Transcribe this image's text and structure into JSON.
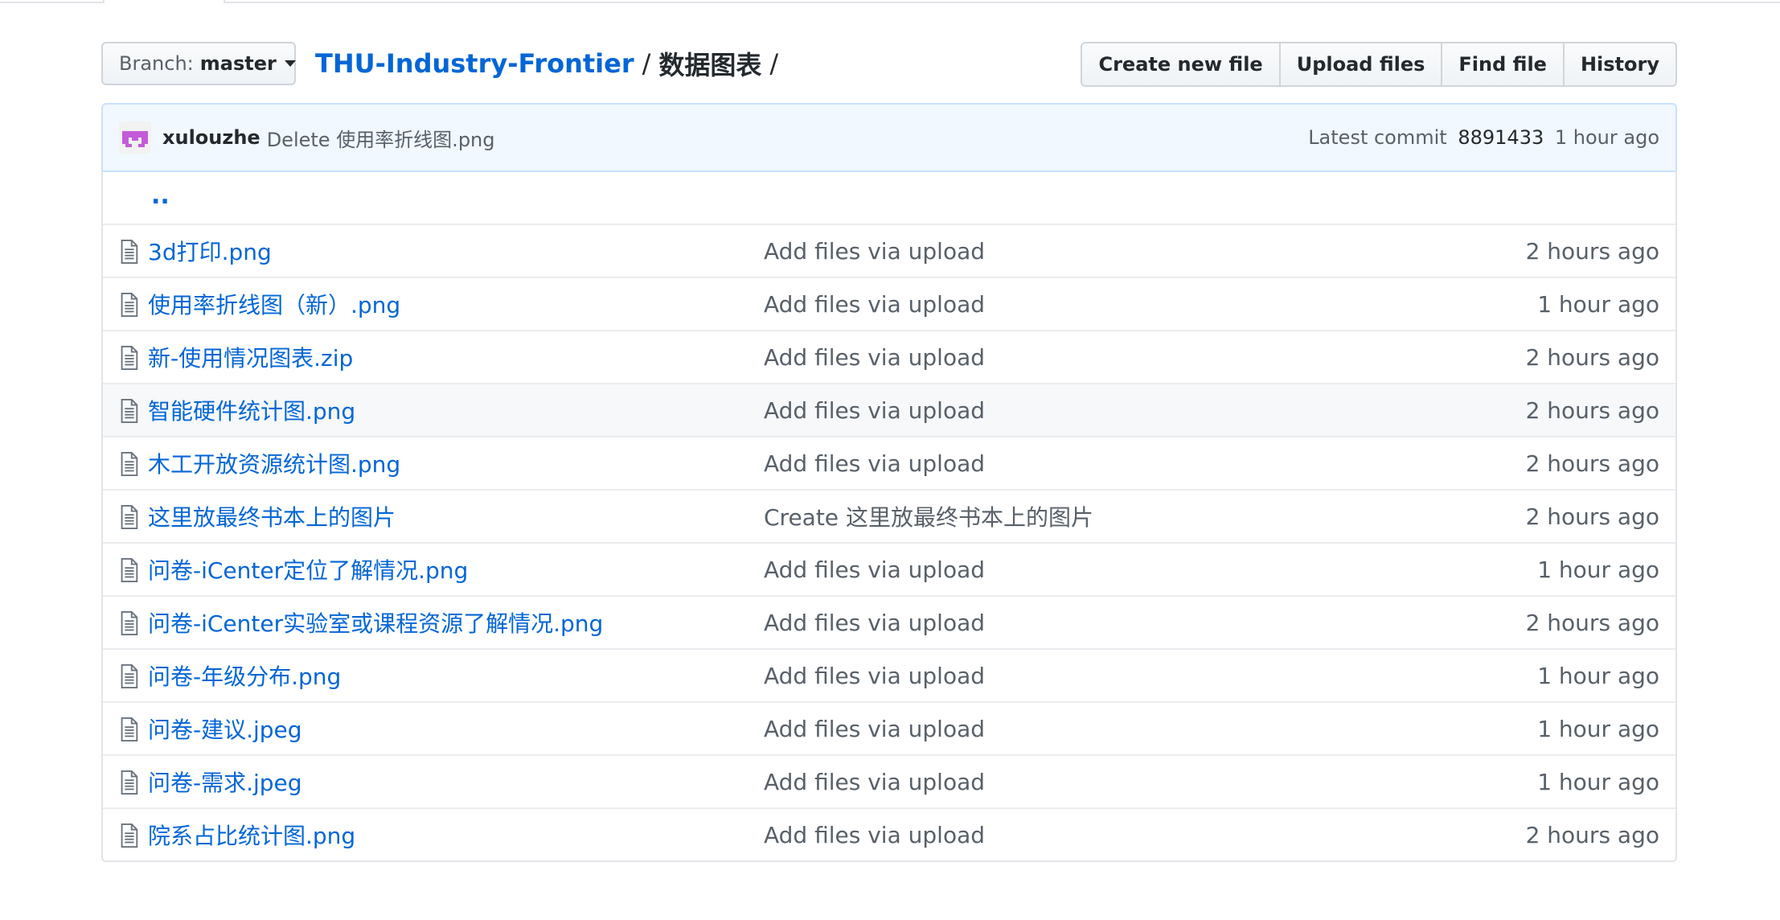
{
  "branch": {
    "prefix": "Branch:",
    "name": "master"
  },
  "breadcrumb": {
    "repo": "THU-Industry-Frontier",
    "separator": "/",
    "current": "数据图表",
    "trailing": "/"
  },
  "buttons": {
    "create_new_file": "Create new file",
    "upload_files": "Upload files",
    "find_file": "Find file",
    "history": "History"
  },
  "commit": {
    "author": "xulouzhe",
    "message": "Delete 使用率折线图.png",
    "latest_label": "Latest commit",
    "sha": "8891433",
    "age": "1 hour ago",
    "avatar_color": "#c35bd9"
  },
  "parent_dir": "..",
  "files": [
    {
      "name": "3d打印.png",
      "message": "Add files via upload",
      "age": "2 hours ago"
    },
    {
      "name": "使用率折线图（新）.png",
      "message": "Add files via upload",
      "age": "1 hour ago"
    },
    {
      "name": "新-使用情况图表.zip",
      "message": "Add files via upload",
      "age": "2 hours ago"
    },
    {
      "name": "智能硬件统计图.png",
      "message": "Add files via upload",
      "age": "2 hours ago"
    },
    {
      "name": "木工开放资源统计图.png",
      "message": "Add files via upload",
      "age": "2 hours ago"
    },
    {
      "name": "这里放最终书本上的图片",
      "message": "Create 这里放最终书本上的图片",
      "age": "2 hours ago"
    },
    {
      "name": "问卷-iCenter定位了解情况.png",
      "message": "Add files via upload",
      "age": "1 hour ago"
    },
    {
      "name": "问卷-iCenter实验室或课程资源了解情况.png",
      "message": "Add files via upload",
      "age": "2 hours ago"
    },
    {
      "name": "问卷-年级分布.png",
      "message": "Add files via upload",
      "age": "1 hour ago"
    },
    {
      "name": "问卷-建议.jpeg",
      "message": "Add files via upload",
      "age": "1 hour ago"
    },
    {
      "name": "问卷-需求.jpeg",
      "message": "Add files via upload",
      "age": "1 hour ago"
    },
    {
      "name": "院系占比统计图.png",
      "message": "Add files via upload",
      "age": "2 hours ago"
    }
  ],
  "icons": {
    "file": "file-icon",
    "caret": "caret-down-icon"
  },
  "colors": {
    "link": "#0366d6",
    "muted": "#586069",
    "commit_bg": "#f1f8ff",
    "commit_border": "#c8e1ff"
  }
}
